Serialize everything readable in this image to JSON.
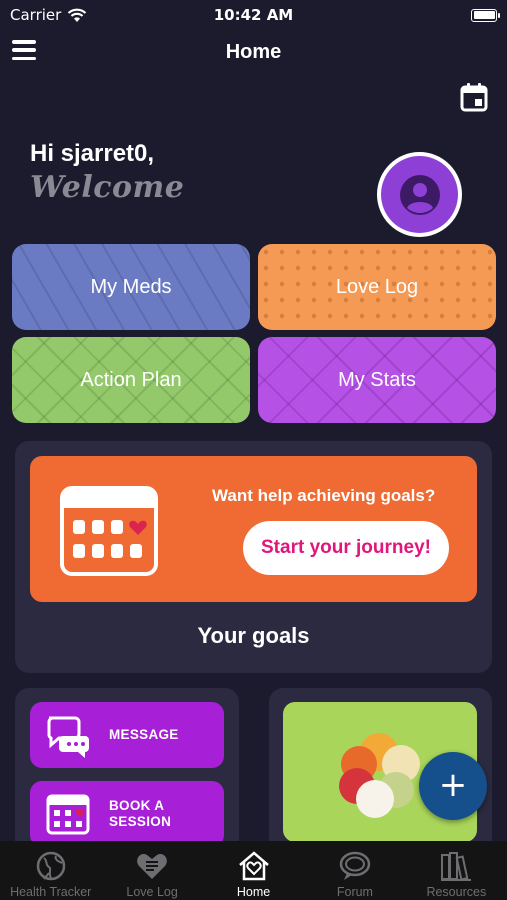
{
  "status_bar": {
    "carrier": "Carrier",
    "time": "10:42 AM"
  },
  "nav": {
    "title": "Home"
  },
  "greeting": {
    "hi": "Hi sjarret0,",
    "welcome": "Welcome"
  },
  "tiles": [
    {
      "label": "My Meds",
      "color": "#6a7bc4"
    },
    {
      "label": "Love Log",
      "color": "#f49a55"
    },
    {
      "label": "Action Plan",
      "color": "#93c96b"
    },
    {
      "label": "My Stats",
      "color": "#b651e5"
    }
  ],
  "goals": {
    "prompt": "Want help achieving goals?",
    "button_label": "Start your journey!",
    "title": "Your goals",
    "accent": "#ef6b33"
  },
  "actions": {
    "message_label": "MESSAGE",
    "book_label": "BOOK A SESSION",
    "color": "#a71fd7"
  },
  "fab": {
    "icon": "plus-icon",
    "color": "#154f8c"
  },
  "tabbar": {
    "items": [
      {
        "label": "Health Tracker",
        "icon": "globe-icon",
        "active": false
      },
      {
        "label": "Love Log",
        "icon": "heart-list-icon",
        "active": false
      },
      {
        "label": "Home",
        "icon": "home-heart-icon",
        "active": true
      },
      {
        "label": "Forum",
        "icon": "chat-bubbles-icon",
        "active": false
      },
      {
        "label": "Resources",
        "icon": "books-icon",
        "active": false
      }
    ]
  }
}
